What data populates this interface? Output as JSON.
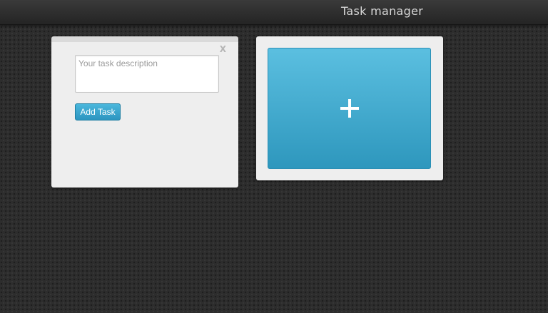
{
  "header": {
    "title": "Task manager"
  },
  "task_card": {
    "close_label": "X",
    "input": {
      "value": "",
      "placeholder": "Your task description"
    },
    "add_button_label": "Add Task"
  },
  "new_task_card": {
    "icon": "plus-icon"
  },
  "colors": {
    "background": "#2d2d2d",
    "card": "#eeeeee",
    "accent": "#3aa6cf",
    "header_text": "#d8d8d8"
  }
}
